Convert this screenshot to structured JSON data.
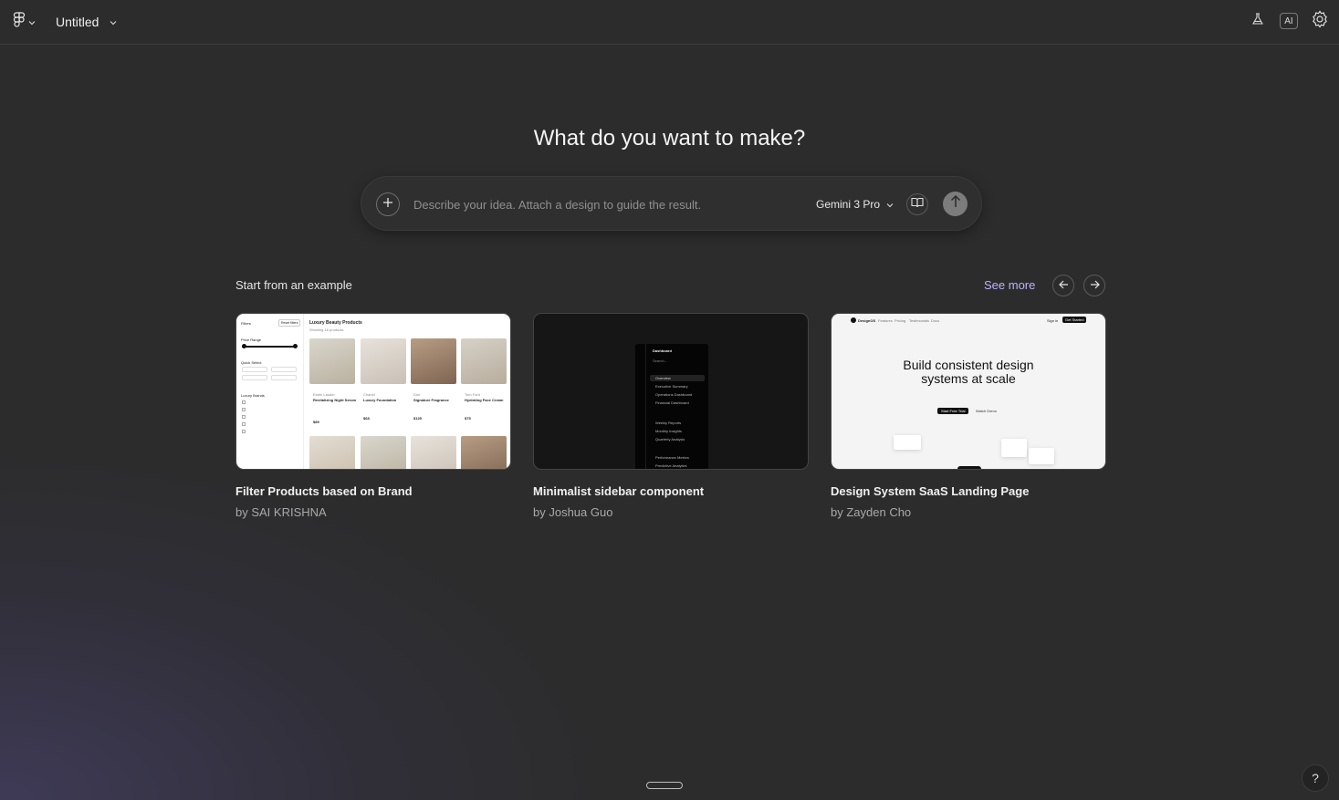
{
  "topbar": {
    "file_title": "Untitled",
    "ai_badge": "AI"
  },
  "main": {
    "heading": "What do you want to make?",
    "prompt": {
      "placeholder": "Describe your idea. Attach a design to guide the result.",
      "model": "Gemini 3 Pro"
    },
    "examples_section": {
      "title": "Start from an example",
      "see_more": "See more"
    },
    "examples": [
      {
        "title": "Filter Products based on Brand",
        "author": "by SAI KRISHNA",
        "thumb": {
          "filters_label": "Filters",
          "reset_label": "Reset filters",
          "heading": "Luxury Beauty Products",
          "subheading": "Showing 16 products",
          "price_range": "Price Range",
          "quick_select": "Quick Select",
          "luxury_brands": "Luxury Brands",
          "products": [
            {
              "brand": "Estée Lauder",
              "name": "Revitalizing Night Serum",
              "price": "$89"
            },
            {
              "brand": "Chanel",
              "name": "Luxury Foundation",
              "price": "$68"
            },
            {
              "brand": "Dior",
              "name": "Signature Fragrance",
              "price": "$125"
            },
            {
              "brand": "Tom Ford",
              "name": "Hydrating Face Cream",
              "price": "$75"
            }
          ]
        }
      },
      {
        "title": "Minimalist sidebar component",
        "author": "by Joshua Guo",
        "thumb": {
          "heading": "Dashboard",
          "search": "Search...",
          "items": [
            "Overview",
            "Executive Summary",
            "Operations Dashboard",
            "Financial Dashboard",
            "Weekly Reports",
            "Monthly Insights",
            "Quarterly Analysis",
            "Performance Metrics",
            "Predictive Analytics"
          ]
        }
      },
      {
        "title": "Design System SaaS Landing Page",
        "author": "by Zayden Cho",
        "thumb": {
          "logo": "DesignOS",
          "nav": [
            "Features",
            "Pricing",
            "Testimonials",
            "Docs"
          ],
          "signin": "Sign in",
          "cta_top": "Get Started",
          "headline_1": "Build consistent design",
          "headline_2": "systems at scale",
          "primary_cta": "Start Free Trial",
          "secondary_cta": "Watch Demo"
        }
      }
    ]
  },
  "help": "?",
  "colors": {
    "background": "#2c2c2c",
    "accent_link": "#b9b3ff",
    "send_button": "#7c7c7c"
  }
}
